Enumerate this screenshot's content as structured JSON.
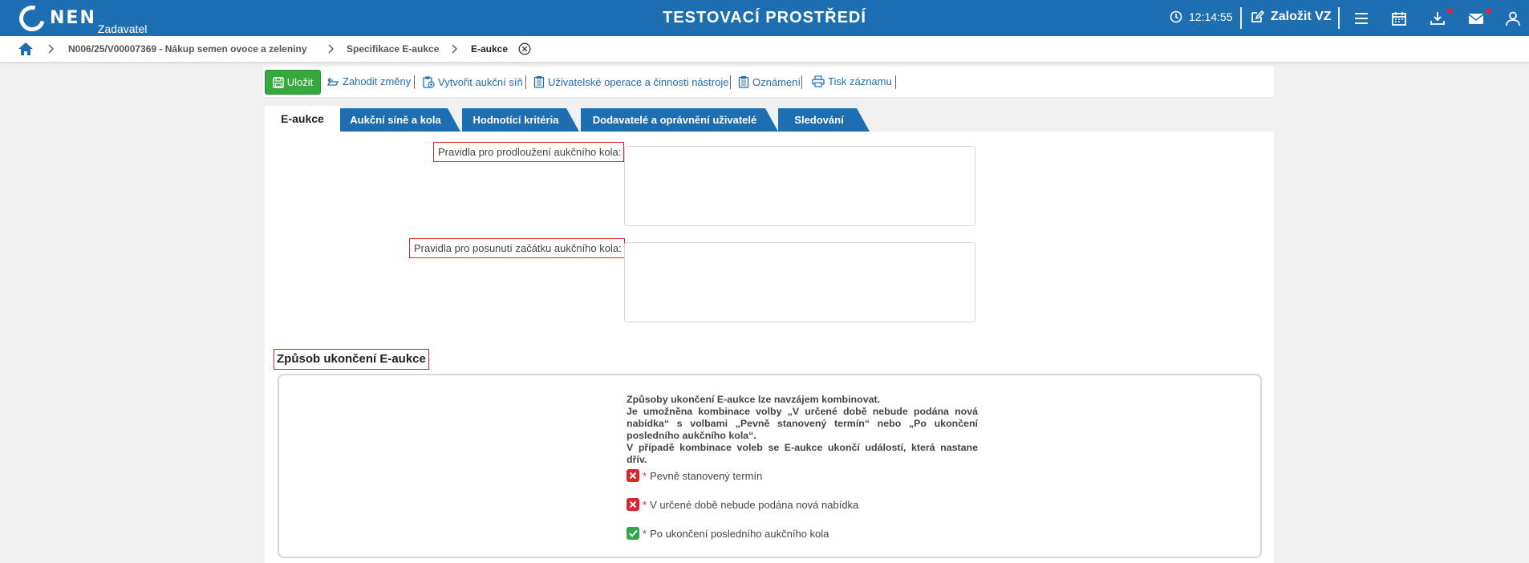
{
  "header": {
    "logo_text": "NEN",
    "role": "Zadavatel",
    "env_title": "TESTOVACÍ PROSTŘEDÍ",
    "time": "12:14:55",
    "new_vz_label": "Založit VZ",
    "icons": [
      "clock-icon",
      "edit-icon",
      "menu-icon",
      "calendar-icon",
      "download-icon",
      "mail-icon",
      "user-icon"
    ]
  },
  "breadcrumb": {
    "items": [
      "N006/25/V00007369 - Nákup semen ovoce a zeleniny",
      "Specifikace E-aukce",
      "E-aukce"
    ]
  },
  "toolbar": {
    "save_label": "Uložit",
    "actions": [
      "Zahodit změny",
      "Vytvořit aukční síň",
      "Uživatelské operace a činnosti nástroje",
      "Oznámení",
      "Tisk záznamu"
    ]
  },
  "tabs": [
    "E-aukce",
    "Aukční síně a kola",
    "Hodnotící kritéria",
    "Dodavatelé a oprávnění uživatelé",
    "Sledování"
  ],
  "form": {
    "extension_rules_label": "Pravidla pro prodloužení aukčního kola:",
    "extension_rules_value": "",
    "shift_start_label": "Pravidla pro posunutí začátku aukčního kola:",
    "shift_start_value": "",
    "section_title": "Způsob ukončení E-aukce",
    "info_lines": [
      "Způsoby ukončení E-aukce lze navzájem kombinovat.",
      "Je umožněna kombinace volby „V určené době nebude podána nová nabídka“ s volbami „Pevně stanovený termín“ nebo „Po ukončení posledního aukčního kola“.",
      "V případě kombinace voleb se E-aukce ukončí událostí, která nastane dřív."
    ],
    "options": [
      {
        "label": "Pevně stanovený termín",
        "checked": false
      },
      {
        "label": "V určené době nebude podána nová nabídka",
        "checked": false
      },
      {
        "label": "Po ukončení posledního aukčního kola",
        "checked": true
      }
    ]
  },
  "colors": {
    "brand": "#1e6fb1",
    "save": "#35a93e",
    "error": "#d9262b",
    "checked": "#2fa84f"
  }
}
